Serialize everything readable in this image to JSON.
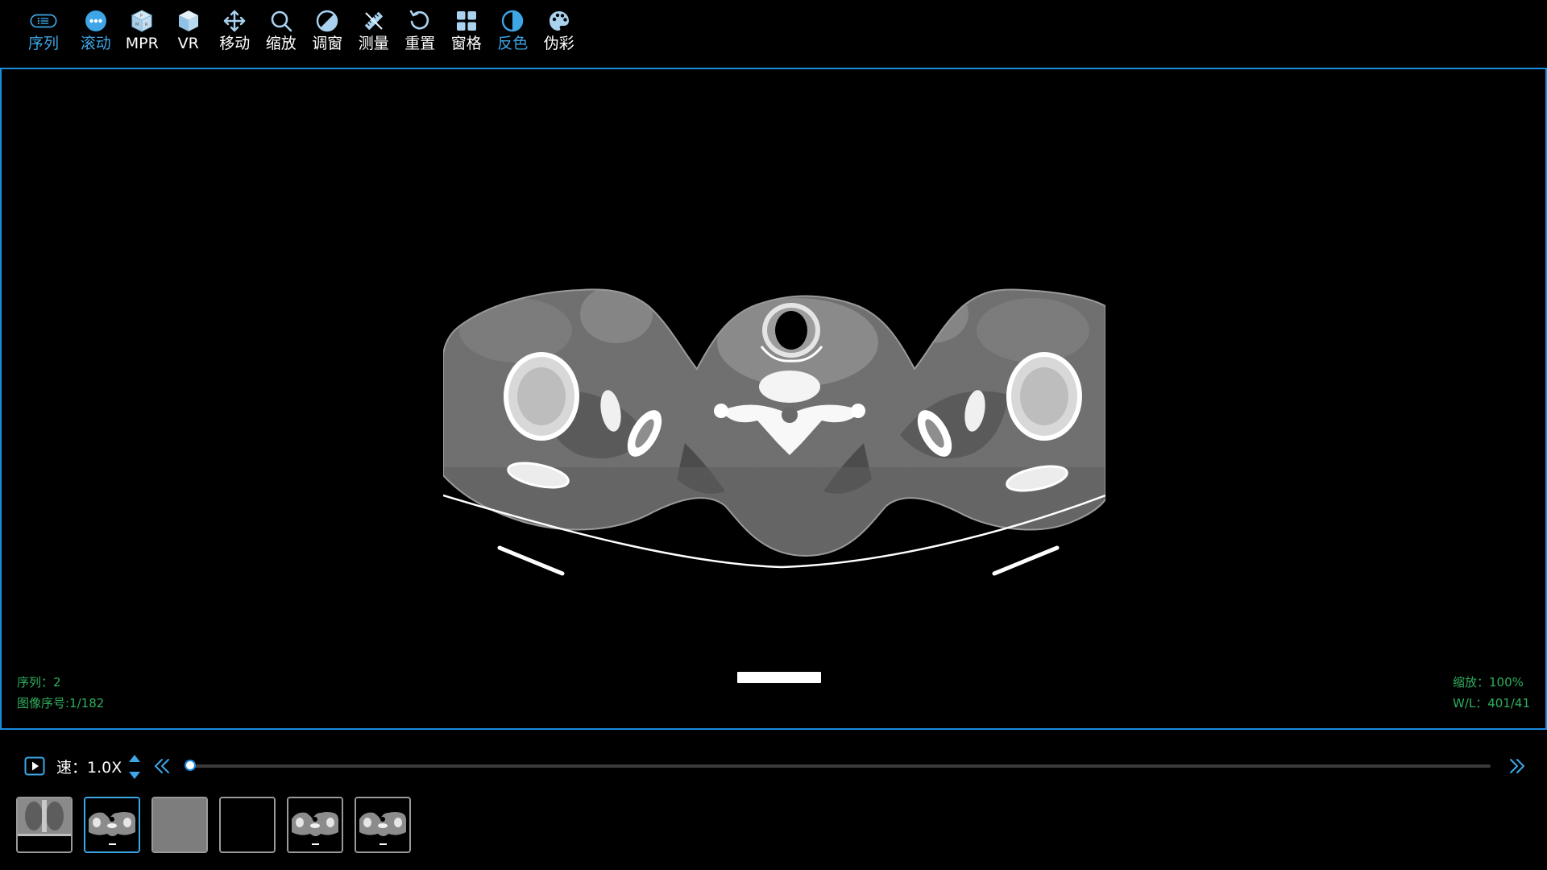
{
  "toolbar": {
    "items": [
      {
        "label": "序列",
        "icon": "list-icon",
        "active": true
      },
      {
        "label": "滚动",
        "icon": "scroll-icon",
        "active": true
      },
      {
        "label": "MPR",
        "icon": "mpr-icon",
        "active": false
      },
      {
        "label": "VR",
        "icon": "cube-icon",
        "active": false
      },
      {
        "label": "移动",
        "icon": "move-icon",
        "active": false
      },
      {
        "label": "缩放",
        "icon": "zoom-icon",
        "active": false
      },
      {
        "label": "调窗",
        "icon": "window-level-icon",
        "active": false
      },
      {
        "label": "测量",
        "icon": "ruler-icon",
        "active": false
      },
      {
        "label": "重置",
        "icon": "reset-icon",
        "active": false
      },
      {
        "label": "窗格",
        "icon": "grid-icon",
        "active": false
      },
      {
        "label": "反色",
        "icon": "invert-icon",
        "active": true
      },
      {
        "label": "伪彩",
        "icon": "palette-icon",
        "active": false
      }
    ]
  },
  "viewer": {
    "series_text": "序列：2",
    "image_index_text": "图像序号:1/182",
    "zoom_text": "缩放：100%",
    "wl_text": "W/L：401/41"
  },
  "playback": {
    "speed_text": "速：1.0X",
    "current_frame": 1,
    "total_frames": 182
  },
  "thumbnails": [
    {
      "kind": "chest-xray",
      "selected": false
    },
    {
      "kind": "axial-ct",
      "selected": true
    },
    {
      "kind": "gray",
      "selected": false
    },
    {
      "kind": "empty",
      "selected": false
    },
    {
      "kind": "axial-ct",
      "selected": false
    },
    {
      "kind": "axial-ct",
      "selected": false
    }
  ],
  "colors": {
    "accent": "#3ea6e6",
    "overlay_text": "#2fae5d",
    "border": "#1b8be0"
  }
}
